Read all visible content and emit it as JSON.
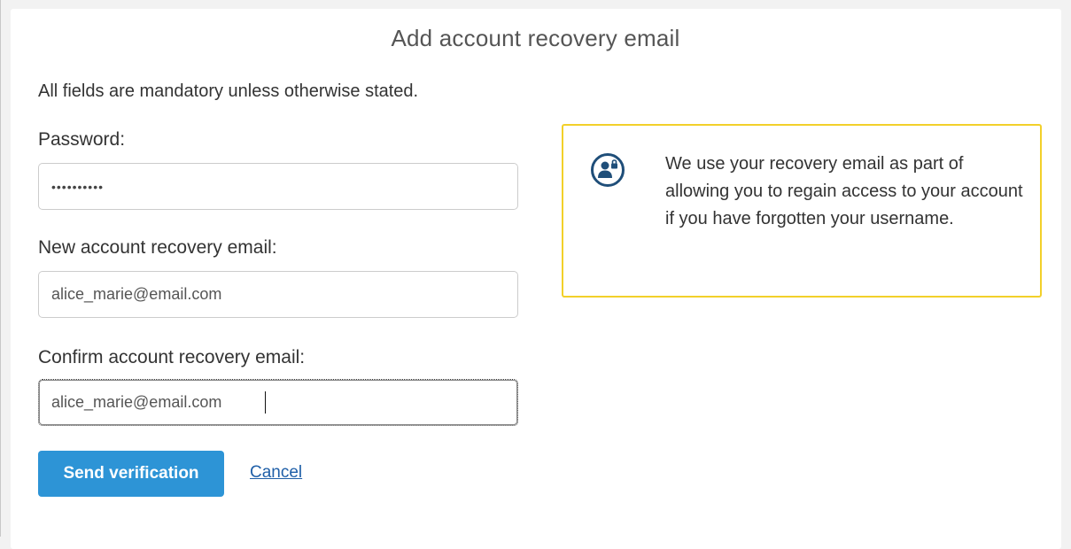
{
  "page": {
    "title": "Add account recovery email",
    "intro": "All fields are mandatory unless otherwise stated."
  },
  "form": {
    "password": {
      "label": "Password:",
      "value": "••••••••••"
    },
    "new_email": {
      "label": "New account recovery email:",
      "value": "alice_marie@email.com"
    },
    "confirm_email": {
      "label": "Confirm account recovery email:",
      "value": "alice_marie@email.com"
    },
    "send_button_label": "Send verification",
    "cancel_link_label": "Cancel"
  },
  "info": {
    "icon": "user-lock-icon",
    "text": "We use your recovery email as part of allowing you to regain access to your account if you have forgotten your username."
  },
  "colors": {
    "primary_button": "#2d94d6",
    "link": "#1f5fa8",
    "info_border": "#f2d02a",
    "icon": "#1f4e79"
  }
}
